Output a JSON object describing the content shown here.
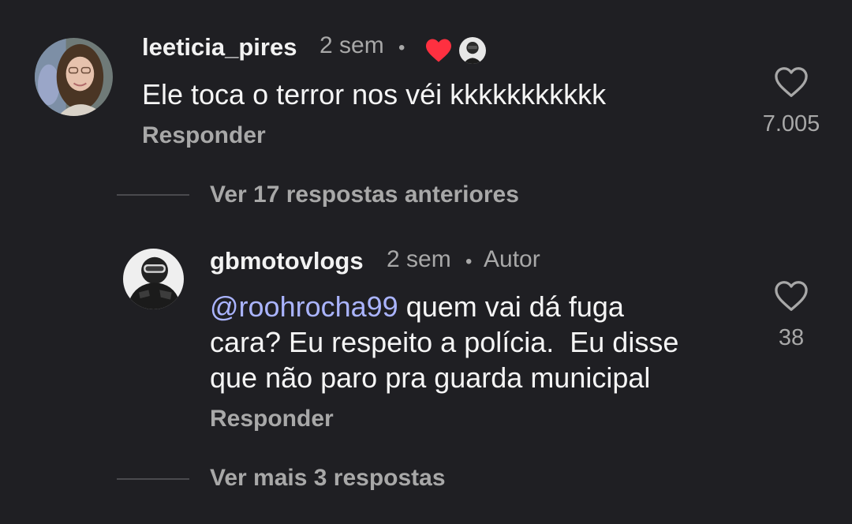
{
  "colors": {
    "background": "#1f1f23",
    "text": "#f5f5f5",
    "muted": "#a8a8a8",
    "mention": "#aab4ff",
    "creator_heart": "#ff3040"
  },
  "comment": {
    "username": "leeticia_pires",
    "time": "2 sem",
    "separator": "•",
    "text": "Ele toca o terror nos véi kkkkkkkkkkk",
    "reply_label": "Responder",
    "like_count": "7.005",
    "creator_liked_icon": "red-heart-icon",
    "like_icon": "heart-outline-icon"
  },
  "thread": {
    "previous_replies_label": "Ver 17 respostas anteriores",
    "more_replies_label": "Ver mais 3 respostas"
  },
  "reply": {
    "username": "gbmotovlogs",
    "time": "2 sem",
    "separator": "•",
    "author_badge": "Autor",
    "mention": "@roohrocha99",
    "text_line1": " quem vai dá fuga",
    "text_line2": "cara? Eu respeito a polícia.  Eu disse",
    "text_line3": "que não paro pra guarda municipal",
    "reply_label": "Responder",
    "like_count": "38",
    "like_icon": "heart-outline-icon"
  }
}
